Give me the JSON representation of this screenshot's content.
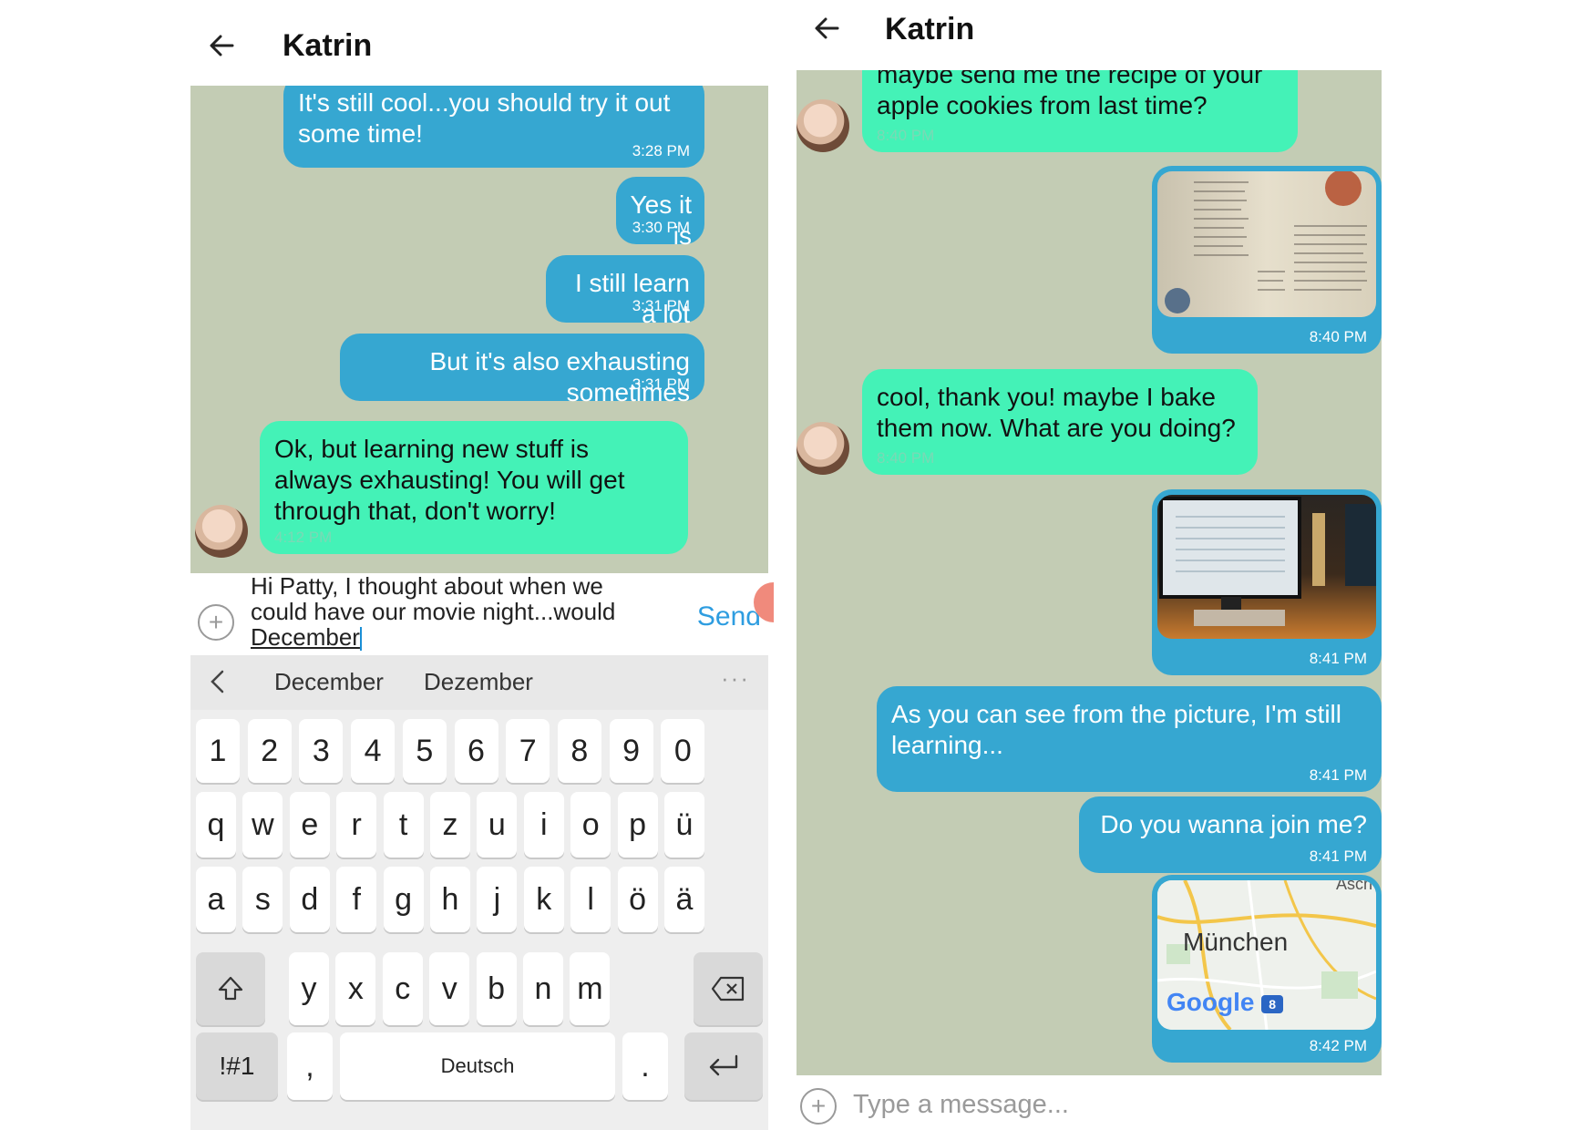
{
  "left": {
    "header": {
      "title": "Katrin",
      "back_icon": "arrow-left-icon"
    },
    "messages": [
      {
        "dir": "out",
        "text": "It's still cool...you should try it out some time!",
        "time": "3:28 PM"
      },
      {
        "dir": "out",
        "text": "Yes it is",
        "time": "3:30 PM"
      },
      {
        "dir": "out",
        "text": "I still learn a lot",
        "time": "3:31 PM"
      },
      {
        "dir": "out",
        "text": "But it's also exhausting sometimes",
        "time": "3:31 PM"
      },
      {
        "dir": "in",
        "text": "Ok, but learning new stuff is always exhausting! You will get through that, don't worry!",
        "time": "4:12 PM"
      }
    ],
    "composer": {
      "draft_line1": "Hi Patty, I thought about when we",
      "draft_line2": "could have our movie night...would",
      "draft_line3": "December",
      "send_label": "Send"
    },
    "keyboard": {
      "suggestions": [
        "December",
        "Dezember"
      ],
      "more": "···",
      "row_numbers": [
        "1",
        "2",
        "3",
        "4",
        "5",
        "6",
        "7",
        "8",
        "9",
        "0"
      ],
      "row1": [
        "q",
        "w",
        "e",
        "r",
        "t",
        "z",
        "u",
        "i",
        "o",
        "p",
        "ü"
      ],
      "row2": [
        "a",
        "s",
        "d",
        "f",
        "g",
        "h",
        "j",
        "k",
        "l",
        "ö",
        "ä"
      ],
      "row3": [
        "y",
        "x",
        "c",
        "v",
        "b",
        "n",
        "m"
      ],
      "symbols_label": "!#1",
      "comma_label": ",",
      "space_label": "Deutsch",
      "period_label": "."
    }
  },
  "right": {
    "header": {
      "title": "Katrin",
      "back_icon": "arrow-left-icon"
    },
    "messages": [
      {
        "dir": "in",
        "text": "maybe send me the recipe of your apple cookies from last time?",
        "time": "8:40 PM"
      },
      {
        "dir": "out",
        "kind": "image",
        "image": "recipe-book-photo",
        "time": "8:40 PM"
      },
      {
        "dir": "in",
        "text": "cool, thank you! maybe I bake them now. What are you doing?",
        "time": "8:40 PM"
      },
      {
        "dir": "out",
        "kind": "image",
        "image": "computer-desk-photo",
        "time": "8:41 PM"
      },
      {
        "dir": "out",
        "text": "As you can see from the picture, I'm still learning...",
        "time": "8:41 PM"
      },
      {
        "dir": "out",
        "text": "Do you wanna join me?",
        "time": "8:41 PM"
      },
      {
        "dir": "out",
        "kind": "map",
        "map_label": "München",
        "map_corner": "Asch",
        "map_brand": "Google",
        "map_badge": "8",
        "time": "8:42 PM"
      }
    ],
    "composer": {
      "placeholder": "Type a message..."
    }
  },
  "colors": {
    "chat_bg": "#c3ccb4",
    "outgoing": "#36a7d1",
    "incoming": "#44f2b7",
    "send": "#2e9de0"
  }
}
